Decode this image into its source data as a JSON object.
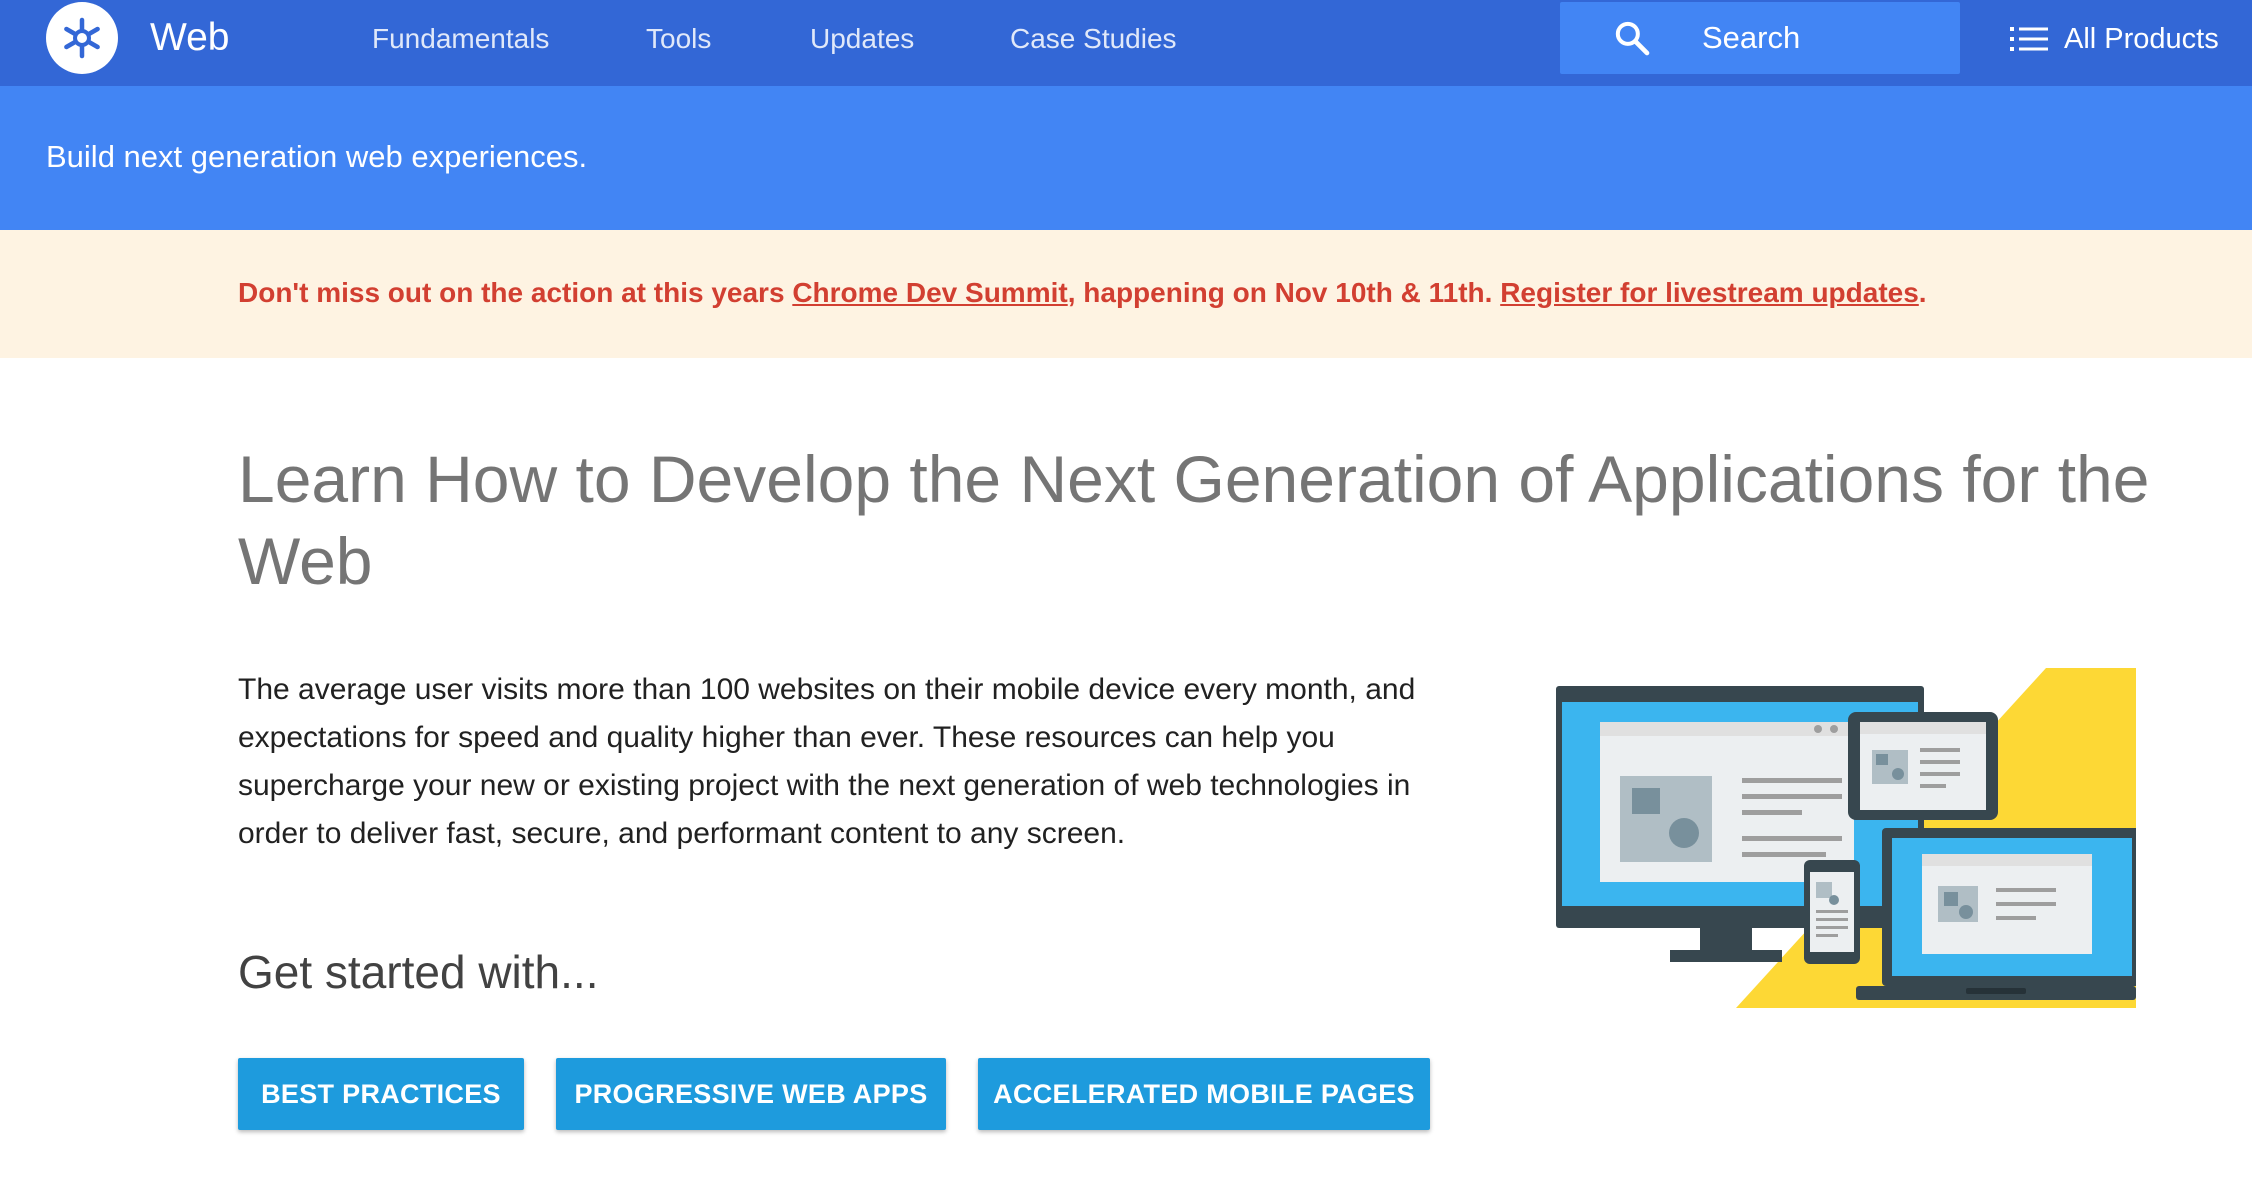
{
  "header": {
    "brand": "Web",
    "logo_icon": "devsite-web-logo-icon",
    "nav": [
      {
        "label": "Fundamentals"
      },
      {
        "label": "Tools"
      },
      {
        "label": "Updates"
      },
      {
        "label": "Case Studies"
      }
    ],
    "search": {
      "placeholder": "Search",
      "icon": "search-icon"
    },
    "products": {
      "label": "All Products",
      "icon": "menu-list-icon"
    }
  },
  "banner": {
    "tagline": "Build next generation web experiences."
  },
  "notice": {
    "text_1": "Don't miss out on the action at this years ",
    "link_1": "Chrome Dev Summit",
    "text_2": ", happening on Nov 10th & 11th. ",
    "link_2": "Register for livestream updates",
    "text_3": "."
  },
  "main": {
    "title": "Learn How to Develop the Next Generation of Applications for the Web",
    "intro": "The average user visits more than 100 websites on their mobile device every month, and expectations for speed and quality higher than ever. These resources can help you supercharge your new or existing project with the next generation of web technologies in order to deliver fast, secure, and performant content to any screen.",
    "subhead": "Get started with...",
    "buttons": [
      {
        "label": "BEST PRACTICES"
      },
      {
        "label": "PROGRESSIVE WEB APPS"
      },
      {
        "label": "ACCELERATED MOBILE PAGES"
      }
    ]
  },
  "colors": {
    "header": "#3367d6",
    "banner": "#4285f4",
    "notice_bg": "#fef3e2",
    "notice_text": "#d23f31",
    "button": "#1e9bdd",
    "illustration_yellow": "#fdd835",
    "illustration_blue": "#3bb5ef"
  }
}
